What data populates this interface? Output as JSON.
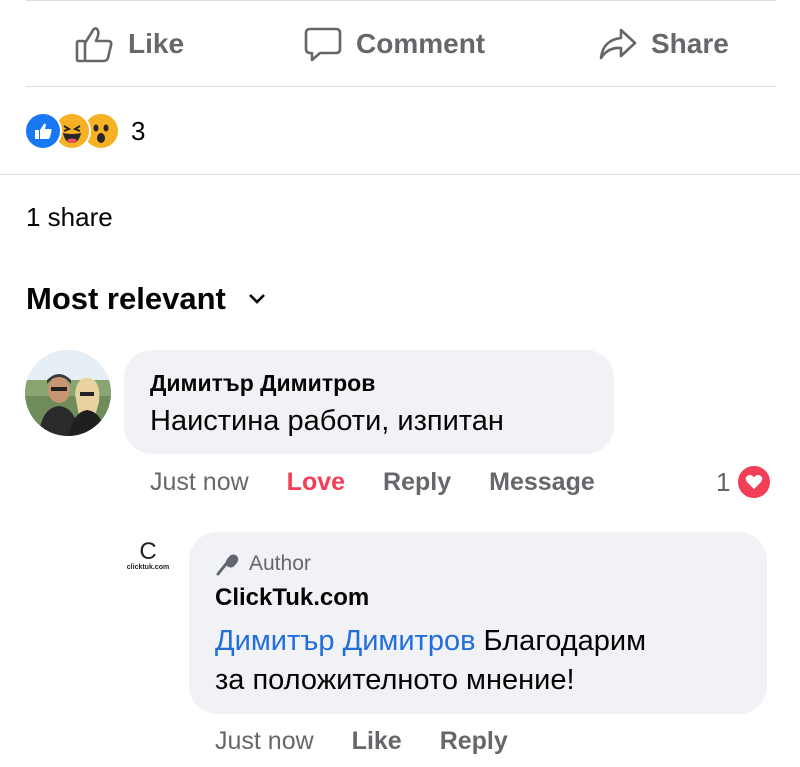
{
  "actions": {
    "like_label": "Like",
    "comment_label": "Comment",
    "share_label": "Share"
  },
  "reactions": {
    "icons": [
      "like-reaction-icon",
      "haha-reaction-icon",
      "wow-reaction-icon"
    ],
    "count": "3"
  },
  "shares_text": "1 share",
  "sort": {
    "label": "Most relevant"
  },
  "comment": {
    "author": "Димитър Димитров",
    "text": "Наистина работи,  изпитан",
    "time": "Just now",
    "reaction_label": "Love",
    "reply_label": "Reply",
    "message_label": "Message",
    "reaction_count": "1"
  },
  "reply": {
    "logo_glyph": "C",
    "logo_text": "clicktuk.com",
    "badge": "Author",
    "author": "ClickTuk.com",
    "mention": "Димитър Димитров",
    "text_line1": " Благодарим",
    "text_line2": "за положителното мнение!",
    "time": "Just now",
    "like_label": "Like",
    "reply_label": "Reply"
  },
  "colors": {
    "accent": "#1877f2",
    "love": "#f33e58",
    "secondary_text": "#65676b",
    "bubble": "#f0f2f5",
    "mention": "#216fdb"
  }
}
